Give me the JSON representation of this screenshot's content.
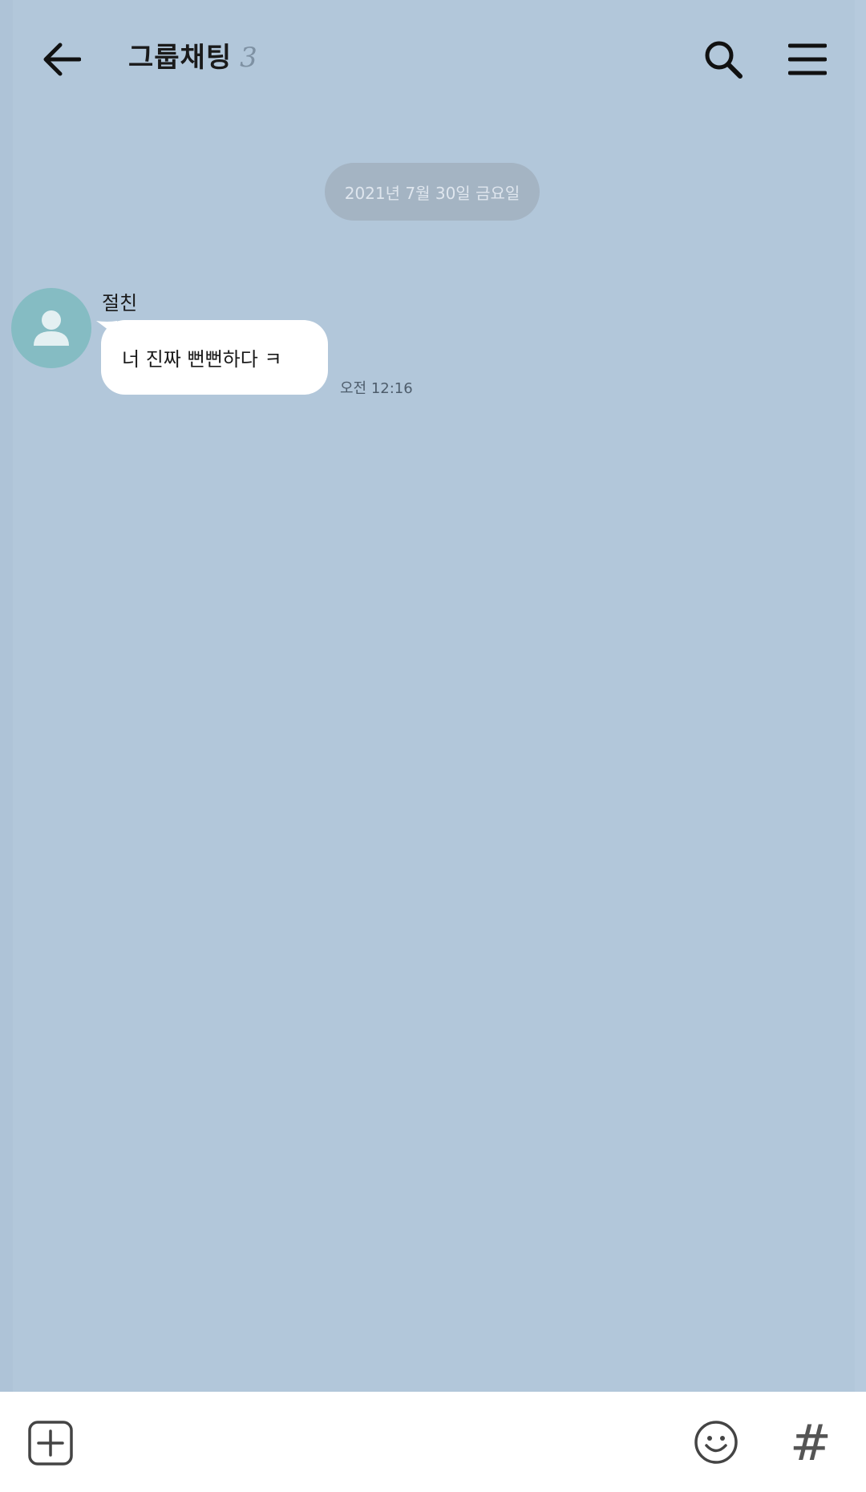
{
  "header": {
    "title": "그룹채팅",
    "member_count": "3",
    "back_icon": "arrow-left-icon",
    "search_icon": "search-icon",
    "menu_icon": "hamburger-menu-icon"
  },
  "chat": {
    "date_divider": "2021년 7월 30일 금요일",
    "messages": [
      {
        "sender": "절친",
        "text": "너 진짜 뻔뻔하다 ㅋ",
        "time": "오전 12:16",
        "avatar_icon": "default-profile-icon"
      }
    ]
  },
  "bottom_bar": {
    "attach_icon": "plus-square-icon",
    "emoji_icon": "smiley-icon",
    "hashtag_label": "#"
  },
  "colors": {
    "background": "#b2c7da",
    "bubble": "#ffffff",
    "avatar": "#85bcc3",
    "date_chip": "#a4b4c3"
  }
}
